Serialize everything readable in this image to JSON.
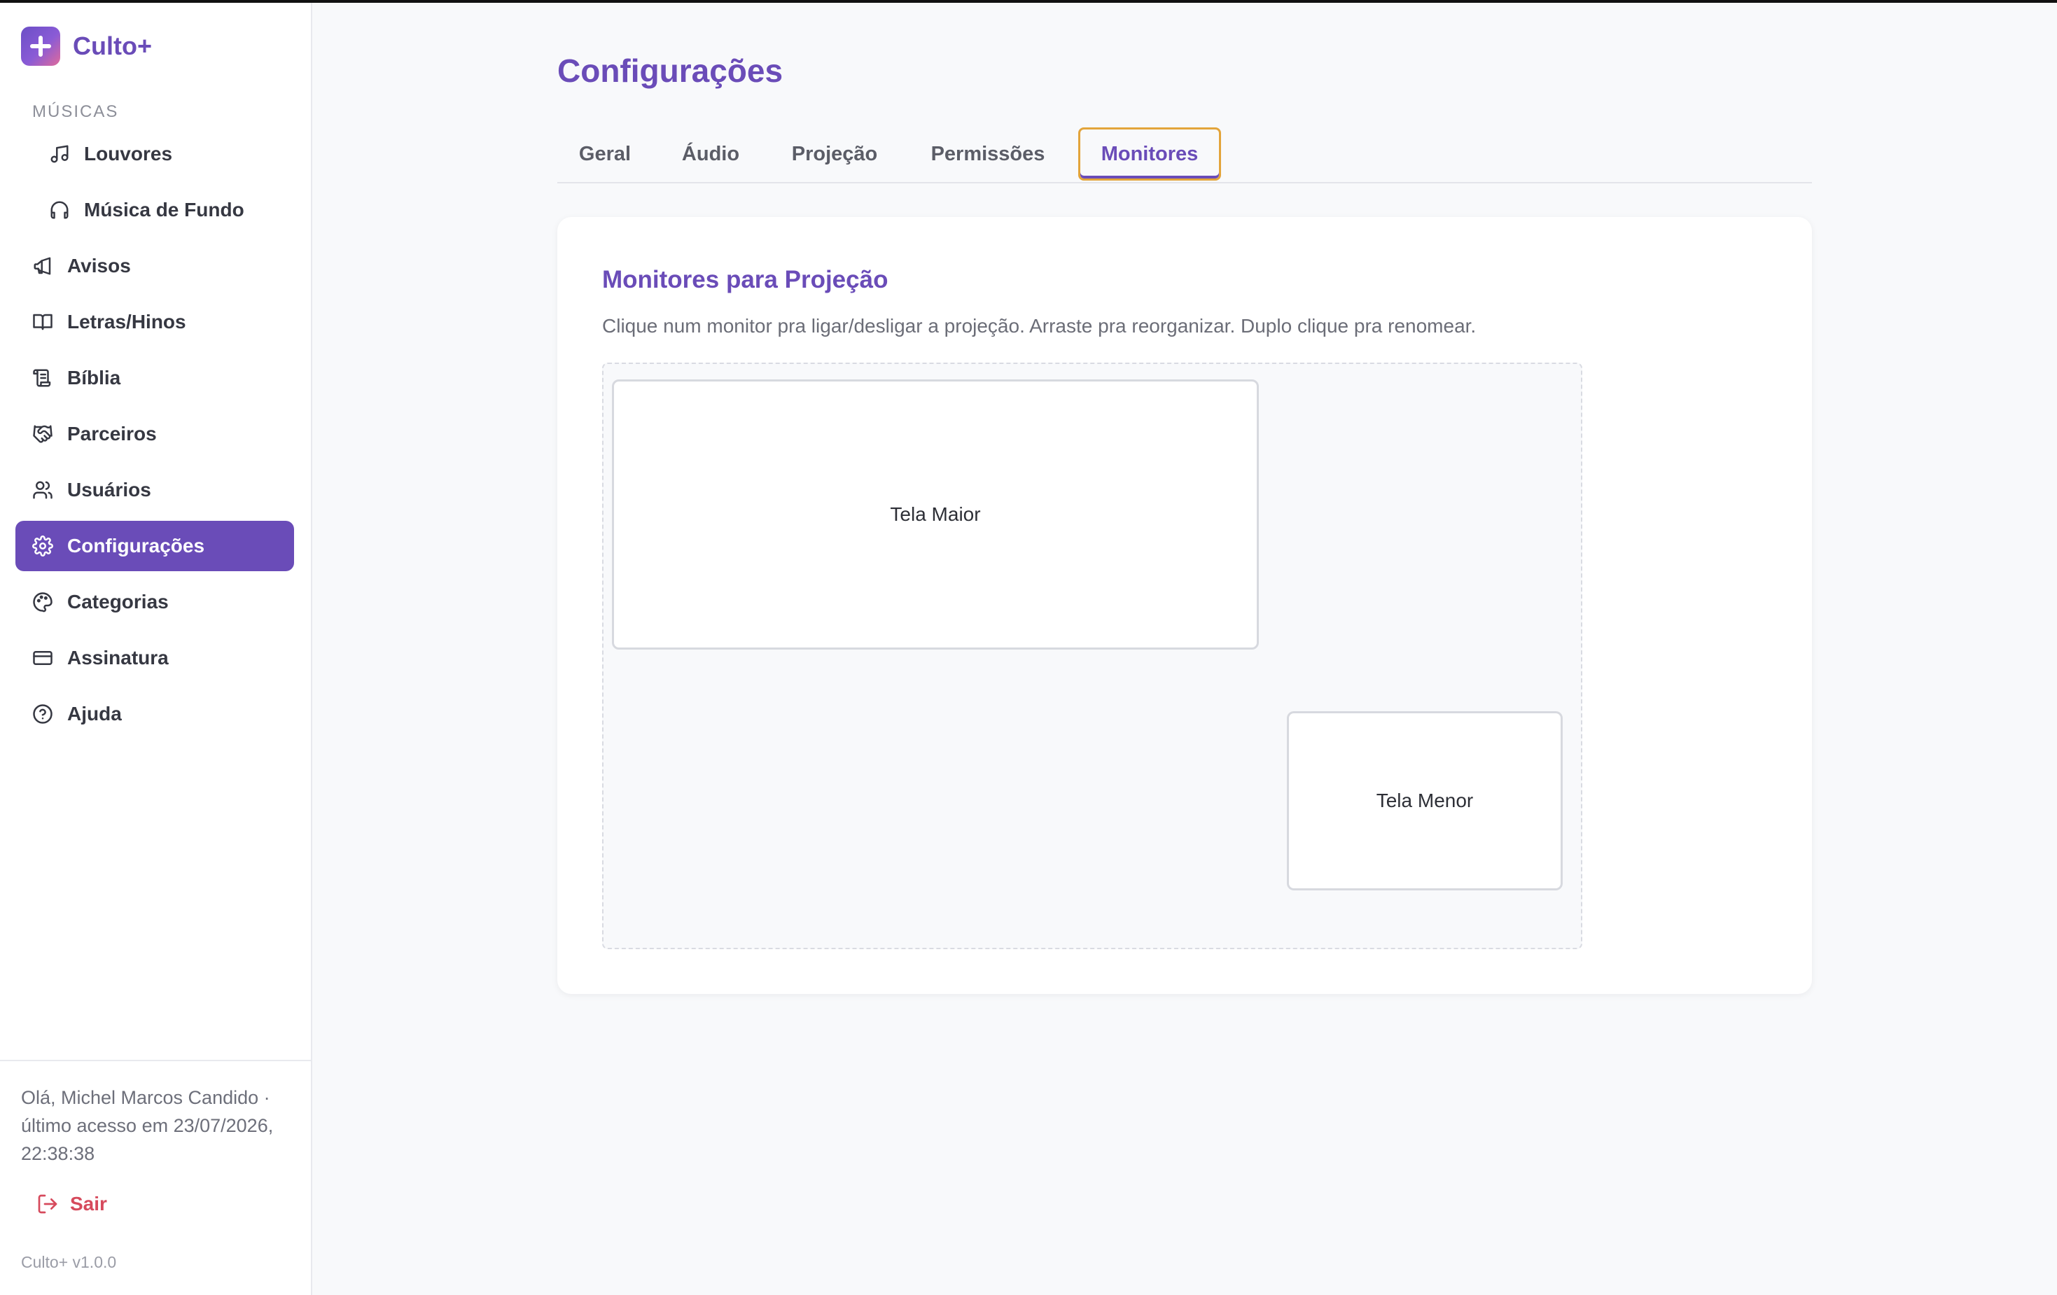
{
  "brand": {
    "name": "Culto+",
    "logo_icon": "plus-icon",
    "accent": "#6a4cb8"
  },
  "sidebar": {
    "section_label": "MÚSICAS",
    "items": [
      {
        "label": "Louvores",
        "icon": "music-note-icon"
      },
      {
        "label": "Música de Fundo",
        "icon": "headphones-icon"
      },
      {
        "label": "Avisos",
        "icon": "megaphone-icon"
      },
      {
        "label": "Letras/Hinos",
        "icon": "book-icon"
      },
      {
        "label": "Bíblia",
        "icon": "scroll-icon"
      },
      {
        "label": "Parceiros",
        "icon": "handshake-icon"
      },
      {
        "label": "Usuários",
        "icon": "users-icon"
      },
      {
        "label": "Configurações",
        "icon": "gear-icon",
        "active": true
      },
      {
        "label": "Categorias",
        "icon": "palette-icon"
      },
      {
        "label": "Assinatura",
        "icon": "credit-card-icon"
      },
      {
        "label": "Ajuda",
        "icon": "help-circle-icon"
      }
    ],
    "greeting": "Olá, Michel Marcos Candido · último acesso em 23/07/2026, 22:38:38",
    "logout_label": "Sair",
    "version": "Culto+ v1.0.0"
  },
  "main": {
    "title": "Configurações",
    "tabs": [
      {
        "label": "Geral"
      },
      {
        "label": "Áudio"
      },
      {
        "label": "Projeção"
      },
      {
        "label": "Permissões"
      },
      {
        "label": "Monitores",
        "active": true
      }
    ],
    "card": {
      "title": "Monitores para Projeção",
      "description": "Clique num monitor pra ligar/desligar a projeção. Arraste pra reorganizar. Duplo clique pra renomear.",
      "monitors": [
        {
          "name": "Tela Maior"
        },
        {
          "name": "Tela Menor"
        }
      ]
    }
  },
  "colors": {
    "accent": "#6a4cb8",
    "active_tab_outline": "#e3a43a",
    "logout": "#d64a5c",
    "background": "#f8f9fb"
  }
}
